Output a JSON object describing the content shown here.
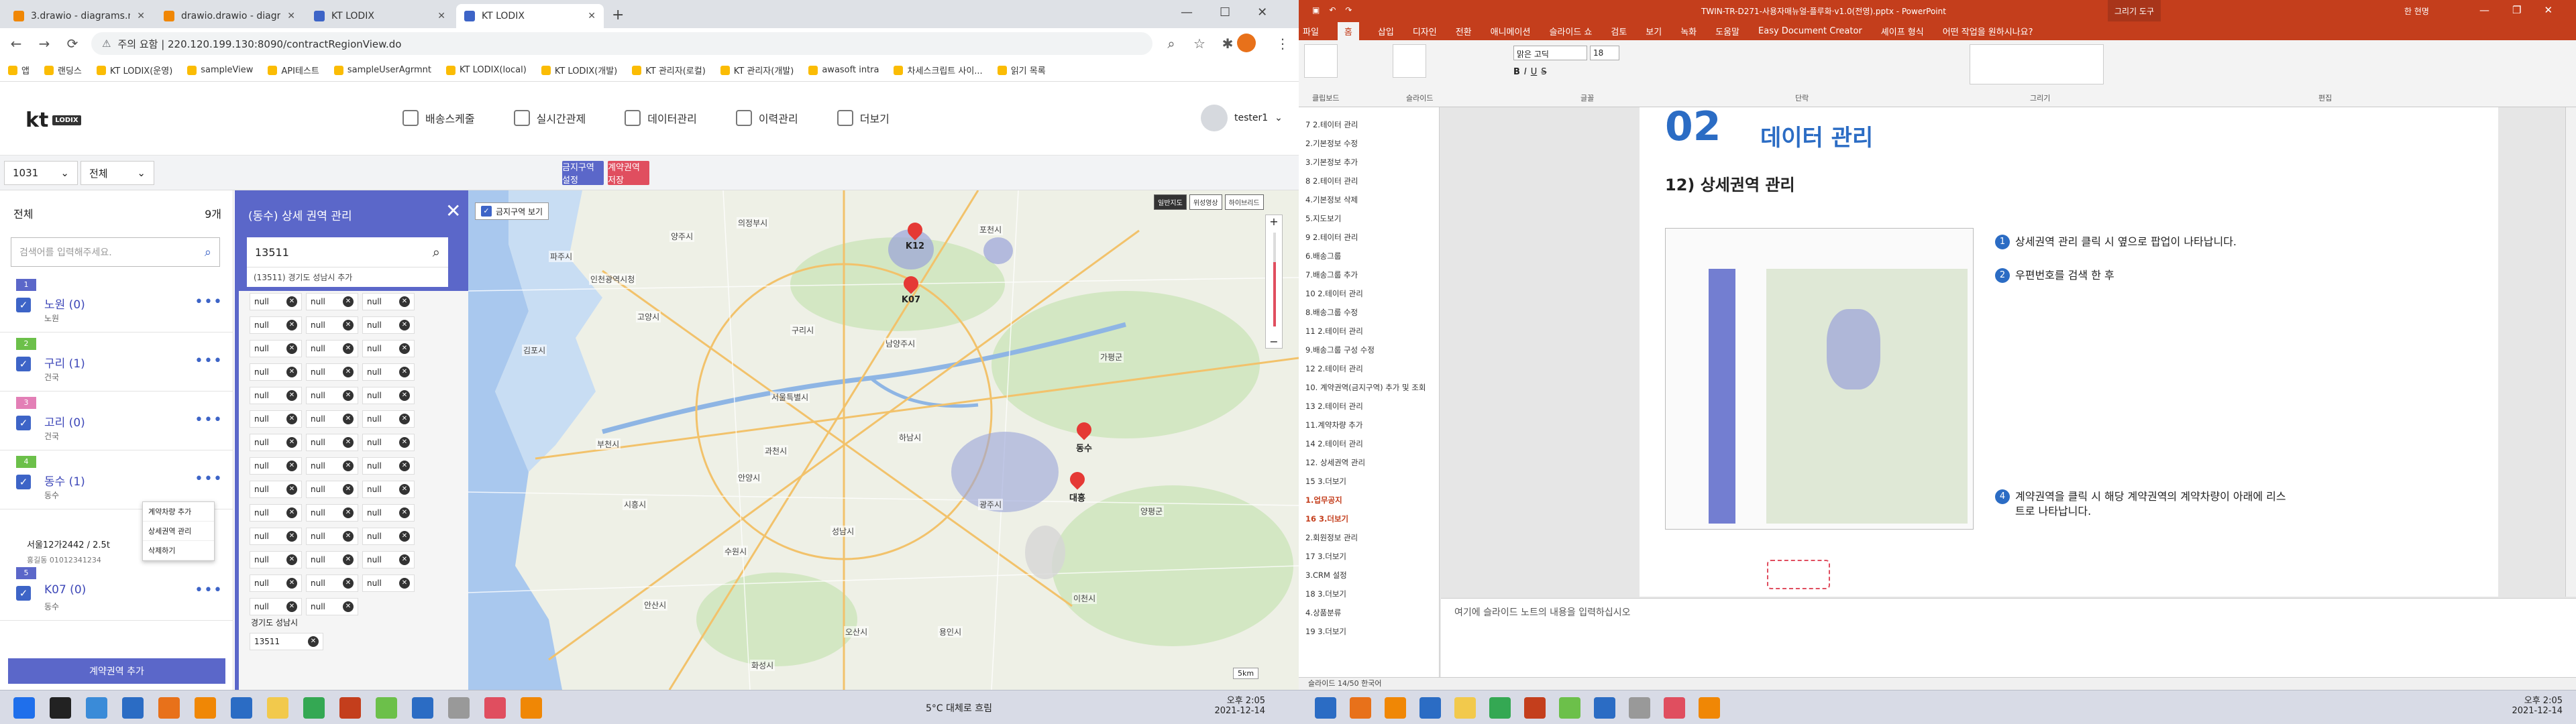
{
  "browser": {
    "tabs": [
      {
        "label": "3.drawio - diagrams.net",
        "color": "#f08705"
      },
      {
        "label": "drawio.drawio - diagrams.net",
        "color": "#f08705"
      },
      {
        "label": "KT LODIX",
        "color": "#3d64c7"
      },
      {
        "label": "KT LODIX",
        "color": "#3d64c7"
      }
    ],
    "address": "주의 요함 | 220.120.199.130:8090/contractRegionView.do",
    "bookmarks": [
      "앱",
      "랜딩스",
      "KT LODIX(운영)",
      "sampleView",
      "API테스트",
      "sampleUserAgrmnt",
      "KT LODIX(local)",
      "KT LODIX(개발)",
      "KT 관리자(로컬)",
      "KT 관리자(개발)",
      "awasoft intra",
      "차세스크립트 사이...",
      "읽기 목록"
    ]
  },
  "app": {
    "logo": {
      "kt": "kt",
      "sub": "LODIX"
    },
    "nav": [
      "배송스케줄",
      "실시간관제",
      "데이터관리",
      "이력관리",
      "더보기"
    ],
    "user": "tester1",
    "filter": {
      "select1": "1031",
      "select2": "전체",
      "btn_settings": "금지구역 설정",
      "btn_save": "계약권역 저장",
      "btn_settings_color": "#5b67c9",
      "btn_save_color": "#e04e5f"
    },
    "left": {
      "title": "전체",
      "count": "9개",
      "search_placeholder": "검색어를 입력해주세요.",
      "items": [
        {
          "num": "1",
          "name": "노원 (0)",
          "sub": "노원",
          "color": "#5b67c9"
        },
        {
          "num": "2",
          "name": "구리 (1)",
          "sub": "건국",
          "color": "#6cc04a"
        },
        {
          "num": "3",
          "name": "고리 (0)",
          "sub": "건국",
          "color": "#e37fb6"
        },
        {
          "num": "4",
          "name": "동수 (1)",
          "sub": "동수",
          "color": "#6cc04a"
        },
        {
          "num": "5",
          "name": "K07 (0)",
          "sub": "동수",
          "color": "#5b67c9"
        }
      ],
      "vehicle": {
        "plate": "서울12가2442 / 2.5t",
        "driver": "홍길동 01012341234"
      },
      "context_menu": [
        "계약차량 추가",
        "상세권역 관리",
        "삭제하기"
      ],
      "add_button": "계약권역 추가"
    },
    "detail": {
      "title": "(동수) 상세 권역 관리",
      "postcode": "13511",
      "suggestion": "(13511) 경기도 성남시  추가",
      "null_value": "null",
      "result_label": "경기도 성남시",
      "result_value": "13511"
    },
    "map": {
      "checkbox_label": "금지구역 보기",
      "map_types": [
        "일반지도",
        "위성영상",
        "하이브리드"
      ],
      "markers": [
        {
          "label": "K12",
          "color": "#e53935"
        },
        {
          "label": "K07",
          "color": "#e53935"
        },
        {
          "label": "동수",
          "color": "#e53935"
        },
        {
          "label": "대흥",
          "color": "#e53935"
        }
      ],
      "places": [
        "인천광역시청",
        "의정부시",
        "양주시",
        "포천시",
        "남양주시",
        "구리시",
        "하남시",
        "성남시",
        "광주시",
        "용인시",
        "수원시",
        "안양시",
        "부천시",
        "시흥시",
        "안산시",
        "과천시",
        "김포시",
        "고양시",
        "파주시",
        "서울특별시",
        "가평군",
        "양평군",
        "이천시",
        "화성시",
        "오산시"
      ],
      "scale": "5km"
    }
  },
  "ppt": {
    "title": "TWIN-TR-D271-사용자매뉴얼-플루화·v1.0(전영).pptx - PowerPoint",
    "draw_tool": "그리기 도구",
    "user": "한 현명",
    "tabs": [
      "파일",
      "홈",
      "삽입",
      "디자인",
      "전환",
      "애니메이션",
      "슬라이드 쇼",
      "검토",
      "보기",
      "녹화",
      "도움말",
      "Easy Document Creator",
      "셰이프 형식",
      "어떤 작업을 원하시나요?"
    ],
    "ribbon_groups": [
      "클립보드",
      "슬라이드",
      "글꼴",
      "단락",
      "그리기",
      "편집"
    ],
    "font_name": "맑은 고딕",
    "font_size": "18",
    "outline": [
      "7   2.테이터 관리",
      "    2.기본정보 수정",
      "    3.기본정보 추가",
      "8   2.테이터 관리",
      "    4.기본정보 삭제",
      "    5.지도보기",
      "9   2.테이터 관리",
      "    6.배송그룹",
      "    7.배송그룹 추가",
      "10  2.테이터 관리",
      "    8.배송그룹 수정",
      "11  2.테이터 관리",
      "    9.배송그룹 구성 수정",
      "12  2.테이터 관리",
      "    10. 계약권역(금지구역) 추가 및 조회",
      "13  2.테이터 관리",
      "    11.계약차량 추가",
      "14  2.테이터 관리",
      "    12. 상세권역 관리",
      "15  3.더보기",
      "    1.업무공지",
      "16  3.더보기",
      "    2.회원정보 관리",
      "17  3.더보기",
      "    3.CRM 설정",
      "18  3.더보기",
      "    4.상품분류",
      "19  3.더보기"
    ],
    "slide": {
      "section_num": "02",
      "section_title": "데이터 관리",
      "subtitle": "12) 상세권역 관리",
      "steps": [
        {
          "n": "1",
          "text": "상세권역 관리 클릭 시 옆으로 팝업이 나타납니다."
        },
        {
          "n": "2",
          "text": "우편번호를 검색 한 후"
        },
        {
          "n": "4",
          "text": "계약권역을 클릭 시 해당 계약권역의 계약차량이 아래에 리스트로 나타납니다."
        }
      ]
    },
    "notes": "여기에 슬라이드 노트의 내용을 입력하십시오",
    "status": "슬라이드 14/50   한국어"
  },
  "taskbar": {
    "weather": "5°C 대체로 흐림",
    "time": "오후 2:05",
    "date": "2021-12-14",
    "time2": "오후 2:05",
    "date2": "2021-12-14"
  }
}
